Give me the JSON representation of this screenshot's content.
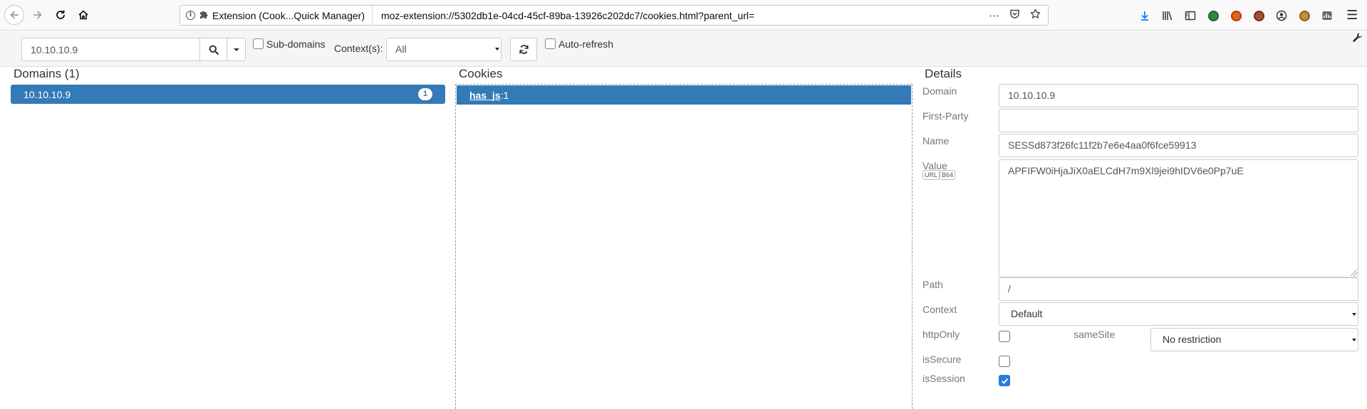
{
  "browser": {
    "tab_identity": "Extension (Cook...Quick Manager)",
    "url": "moz-extension://5302db1e-04cd-45cf-89ba-13926c202dc7/cookies.html?parent_url=",
    "page_actions_icon": "ellipsis-icon",
    "pocket_icon": "pocket-icon",
    "bookmark_icon": "star-icon",
    "toolbar_icons": [
      "download-icon",
      "library-icon",
      "sidebar-icon",
      "extension-green-icon",
      "extension-orange-icon",
      "cookie-brown-icon",
      "account-icon",
      "cookie-icon",
      "chart-icon"
    ],
    "colors": {
      "download_accent": "#0a84ff"
    }
  },
  "toolbar": {
    "search_value": "10.10.10.9",
    "subdomains_label": "Sub-domains",
    "context_label": "Context(s):",
    "context_value": "All",
    "autorefresh_label": "Auto-refresh"
  },
  "domains": {
    "title": "Domains (1)",
    "items": [
      {
        "name": "10.10.10.9",
        "count": "1"
      }
    ]
  },
  "cookies": {
    "title": "Cookies",
    "items": [
      {
        "name": "has_js",
        "suffix": ":1"
      }
    ]
  },
  "details": {
    "title": "Details",
    "domain_label": "Domain",
    "domain_value": "10.10.10.9",
    "first_party_label": "First-Party",
    "first_party_value": "",
    "name_label": "Name",
    "name_value": "SESSd873f26fc11f2b7e6e4aa0f6fce59913",
    "value_label": "Value",
    "url_btn": "URL",
    "b64_btn": "B64",
    "value_value": "APFIFW0iHjaJiX0aELCdH7m9Xl9jei9hIDV6e0Pp7uE",
    "path_label": "Path",
    "path_value": "/",
    "context_label": "Context",
    "context_value": "Default",
    "httponly_label": "httpOnly",
    "samesite_label": "sameSite",
    "samesite_value": "No restriction",
    "issecure_label": "isSecure",
    "issession_label": "isSession",
    "httponly_checked": false,
    "issecure_checked": false,
    "issession_checked": true,
    "colors": {
      "selection": "#337ab7",
      "checkbox_checked": "#2a7be0"
    }
  }
}
